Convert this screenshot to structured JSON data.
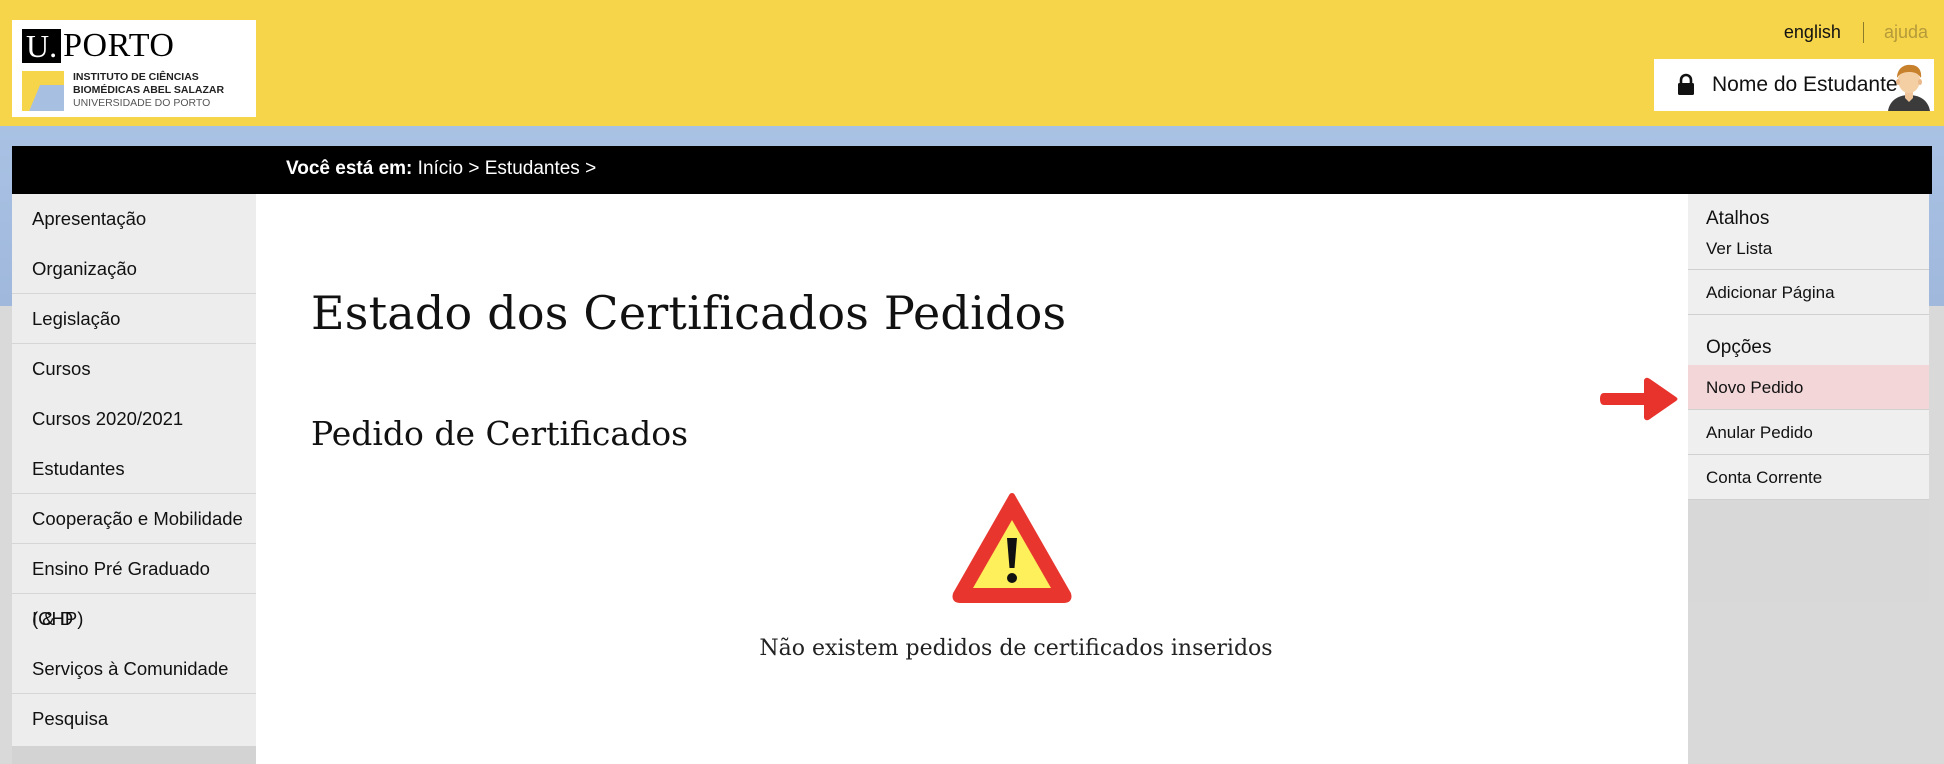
{
  "header": {
    "logo": {
      "u": "U.",
      "porto": "PORTO",
      "line1": "INSTITUTO DE CIÊNCIAS",
      "line2": "BIOMÉDICAS ABEL SALAZAR",
      "line3": "UNIVERSIDADE DO PORTO"
    },
    "lang_link": "english",
    "help_link": "ajuda",
    "user_name": "Nome do Estudante"
  },
  "breadcrumb": {
    "label": "Você está em:",
    "path": "Início > Estudantes >"
  },
  "sidebar": {
    "items": [
      "Apresentação",
      "Organização",
      "Legislação",
      "Cursos",
      "Cursos 2020/2021",
      "Estudantes",
      "Cooperação e Mobilidade",
      "Ensino Pré Graduado (CHP)",
      "I & D",
      "Serviços à Comunidade",
      "Pesquisa"
    ]
  },
  "main": {
    "title": "Estado dos Certificados Pedidos",
    "section_title": "Pedido de Certificados",
    "empty_message": "Não existem pedidos de certificados inseridos"
  },
  "right_panel": {
    "shortcuts_heading": "Atalhos",
    "shortcuts": [
      "Ver Lista",
      "Adicionar Página"
    ],
    "options_heading": "Opções",
    "options": [
      "Novo Pedido",
      "Anular Pedido",
      "Conta Corrente"
    ]
  },
  "colors": {
    "header_yellow": "#f6d54a",
    "band_blue": "#a9c2e4",
    "active_option_bg": "#f2d6d8",
    "arrow_red": "#e8322c",
    "warning_red": "#e8362e",
    "warning_yellow": "#fdf05a"
  },
  "icons": [
    "lock-icon",
    "user-avatar-icon",
    "warning-icon",
    "right-arrow-icon"
  ]
}
